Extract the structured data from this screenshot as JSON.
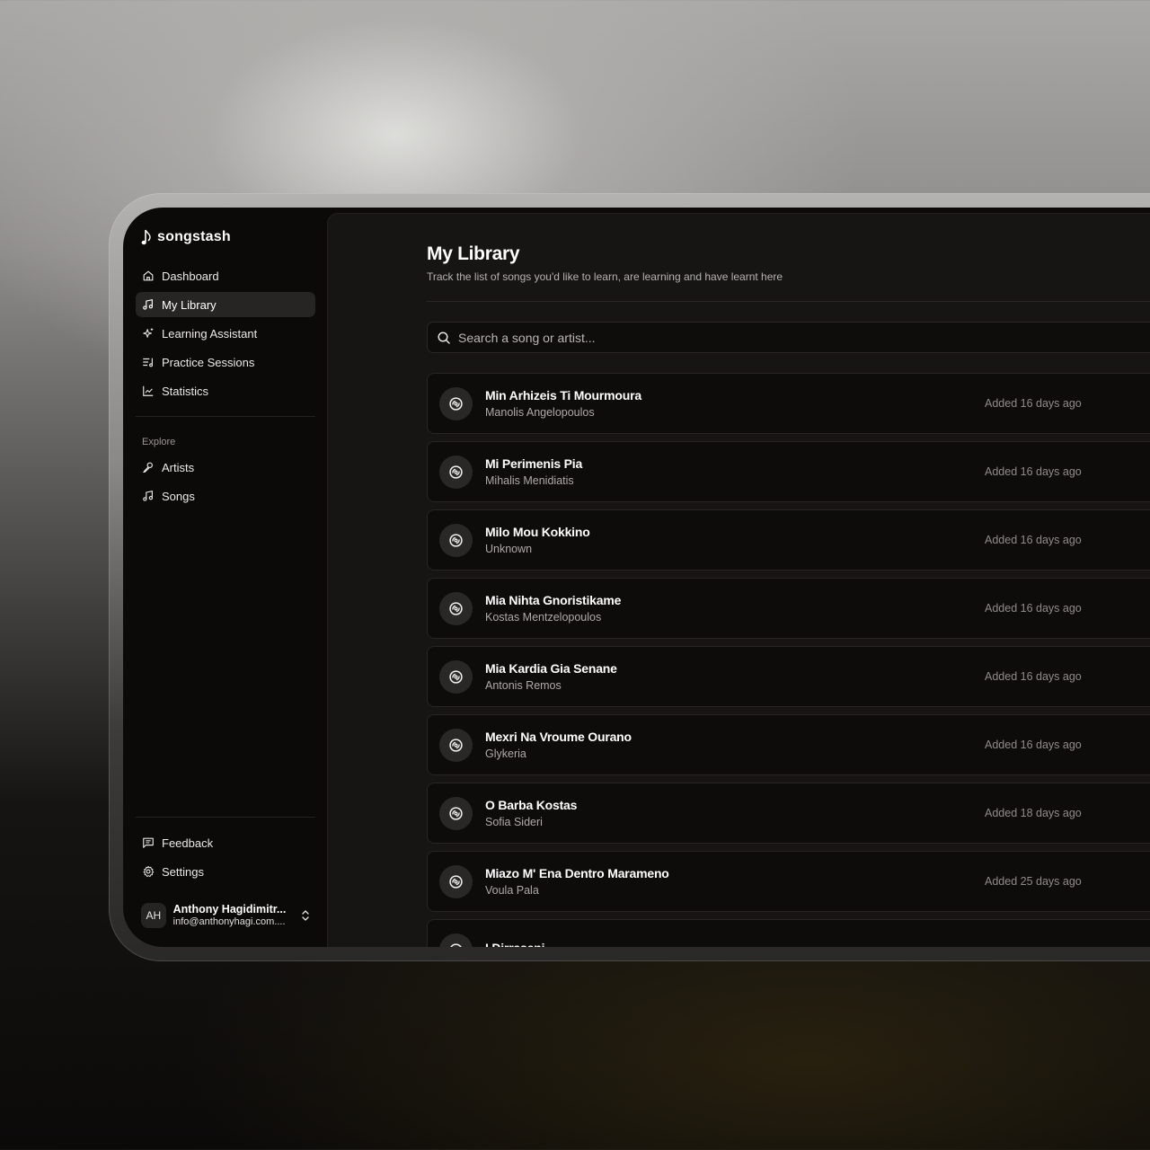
{
  "app": {
    "name": "songstash"
  },
  "sidebar": {
    "nav": [
      {
        "label": "Dashboard",
        "icon": "home-icon",
        "active": false
      },
      {
        "label": "My Library",
        "icon": "music-notes-icon",
        "active": true
      },
      {
        "label": "Learning Assistant",
        "icon": "sparkles-icon",
        "active": false
      },
      {
        "label": "Practice Sessions",
        "icon": "list-music-icon",
        "active": false
      },
      {
        "label": "Statistics",
        "icon": "line-chart-icon",
        "active": false
      }
    ],
    "explore_label": "Explore",
    "explore": [
      {
        "label": "Artists",
        "icon": "microphone-icon"
      },
      {
        "label": "Songs",
        "icon": "music-notes-icon"
      }
    ],
    "footer": [
      {
        "label": "Feedback",
        "icon": "message-square-icon"
      },
      {
        "label": "Settings",
        "icon": "gear-icon"
      }
    ],
    "user": {
      "initials": "AH",
      "name": "Anthony Hagidimitr...",
      "email": "info@anthonyhagi.com...."
    }
  },
  "main": {
    "title": "My Library",
    "subtitle": "Track the list of songs you'd like to learn, are learning and have learnt here",
    "search": {
      "placeholder": "Search a song or artist...",
      "value": ""
    },
    "songs": [
      {
        "title": "Min Arhizeis Ti Mourmoura",
        "artist": "Manolis Angelopoulos",
        "added": "Added 16 days ago"
      },
      {
        "title": "Mi Perimenis Pia",
        "artist": "Mihalis Menidiatis",
        "added": "Added 16 days ago"
      },
      {
        "title": "Milo Mou Kokkino",
        "artist": "Unknown",
        "added": "Added 16 days ago"
      },
      {
        "title": "Mia Nihta Gnoristikame",
        "artist": "Kostas Mentzelopoulos",
        "added": "Added 16 days ago"
      },
      {
        "title": "Mia Kardia Gia Senane",
        "artist": "Antonis Remos",
        "added": "Added 16 days ago"
      },
      {
        "title": "Mexri Na Vroume Ourano",
        "artist": "Glykeria",
        "added": "Added 16 days ago"
      },
      {
        "title": "O Barba Kostas",
        "artist": "Sofia Sideri",
        "added": "Added 18 days ago"
      },
      {
        "title": "Miazo M' Ena Dentro Marameno",
        "artist": "Voula Pala",
        "added": "Added 25 days ago"
      },
      {
        "title": "I Dirraseni",
        "artist": "",
        "added": ""
      }
    ]
  }
}
